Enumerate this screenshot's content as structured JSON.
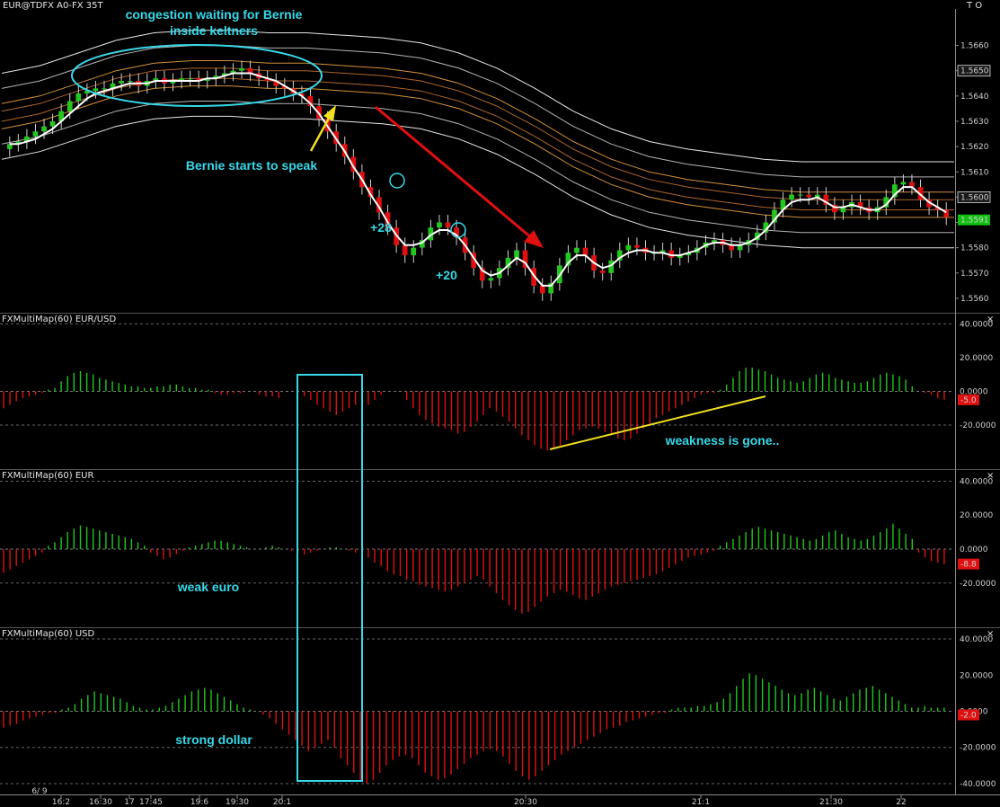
{
  "header": {
    "title": "EUR@TDFX A0-FX 35T",
    "right_label": "T O",
    "close_glyph": "×"
  },
  "colors": {
    "bg": "#000000",
    "up": "#22c81e",
    "down": "#e01010",
    "cyan": "#38d8e8",
    "yellow": "#f0e020",
    "red_arrow": "#e01010",
    "ma": "#ffffff",
    "price_tag_green": "#10c010"
  },
  "chart_data": [
    {
      "type": "candlestick",
      "title": "EUR@TDFX A0-FX 35T",
      "ylim": [
        1.5555,
        1.5673
      ],
      "y_ticks": [
        "1.5660",
        "1.5650",
        "1.5640",
        "1.5630",
        "1.5620",
        "1.5610",
        "1.5600",
        "1.5590",
        "1.5580",
        "1.5570",
        "1.5560"
      ],
      "price_tags": [
        {
          "value": "1.5650",
          "style": "box"
        },
        {
          "value": "1.5600",
          "style": "box"
        },
        {
          "value": "1.5591",
          "style": "green"
        }
      ],
      "x_labels": [
        "6/ 9",
        "16:2",
        "16:30",
        "17",
        "17:45",
        "19:6",
        "19:30",
        "20:1",
        "20:30",
        "21:1",
        "21:30",
        "22"
      ],
      "close": [
        1.5621,
        1.5622,
        1.5624,
        1.5626,
        1.5628,
        1.563,
        1.5634,
        1.5638,
        1.5641,
        1.5642,
        1.5643,
        1.5643,
        1.5645,
        1.5646,
        1.5646,
        1.5644,
        1.5646,
        1.5647,
        1.5645,
        1.5646,
        1.5647,
        1.5647,
        1.5646,
        1.5647,
        1.5648,
        1.5649,
        1.565,
        1.5651,
        1.5649,
        1.5647,
        1.5646,
        1.5644,
        1.5643,
        1.5641,
        1.564,
        1.5636,
        1.5631,
        1.5626,
        1.5621,
        1.5616,
        1.561,
        1.5604,
        1.56,
        1.5594,
        1.5588,
        1.5581,
        1.5577,
        1.558,
        1.5583,
        1.5588,
        1.559,
        1.5588,
        1.5584,
        1.5578,
        1.5572,
        1.5567,
        1.5568,
        1.5572,
        1.5576,
        1.5579,
        1.5572,
        1.5565,
        1.5562,
        1.5566,
        1.5573,
        1.5578,
        1.558,
        1.5577,
        1.5571,
        1.557,
        1.5575,
        1.5579,
        1.5581,
        1.558,
        1.5578,
        1.5578,
        1.5579,
        1.5576,
        1.5577,
        1.5578,
        1.558,
        1.5582,
        1.5583,
        1.5581,
        1.5579,
        1.5581,
        1.5583,
        1.5586,
        1.559,
        1.5595,
        1.5599,
        1.5601,
        1.5601,
        1.56,
        1.5601,
        1.5597,
        1.5594,
        1.5596,
        1.5598,
        1.5596,
        1.5594,
        1.5596,
        1.56,
        1.5605,
        1.5606,
        1.5604,
        1.5599,
        1.5596,
        1.5595,
        1.5592
      ],
      "ma": [
        1.5621,
        1.5621,
        1.5622,
        1.5623,
        1.5625,
        1.5627,
        1.563,
        1.5633,
        1.5636,
        1.5639,
        1.5641,
        1.5642,
        1.5643,
        1.5644,
        1.5645,
        1.5645,
        1.5645,
        1.5646,
        1.5646,
        1.5646,
        1.5646,
        1.5646,
        1.5646,
        1.5647,
        1.5647,
        1.5648,
        1.5649,
        1.5649,
        1.5649,
        1.5648,
        1.5647,
        1.5646,
        1.5644,
        1.5642,
        1.564,
        1.5637,
        1.5633,
        1.5628,
        1.5623,
        1.5618,
        1.5612,
        1.5607,
        1.5601,
        1.5596,
        1.559,
        1.5585,
        1.5581,
        1.5581,
        1.5582,
        1.5585,
        1.5587,
        1.5587,
        1.5585,
        1.5581,
        1.5576,
        1.5571,
        1.5569,
        1.557,
        1.5573,
        1.5576,
        1.5574,
        1.5569,
        1.5565,
        1.5565,
        1.5569,
        1.5574,
        1.5577,
        1.5577,
        1.5574,
        1.5572,
        1.5573,
        1.5576,
        1.5578,
        1.5579,
        1.5579,
        1.5578,
        1.5578,
        1.5577,
        1.5577,
        1.5578,
        1.5579,
        1.5581,
        1.5582,
        1.5582,
        1.5581,
        1.5581,
        1.5582,
        1.5584,
        1.5587,
        1.5591,
        1.5595,
        1.5598,
        1.5599,
        1.5599,
        1.56,
        1.5598,
        1.5596,
        1.5596,
        1.5597,
        1.5596,
        1.5595,
        1.5595,
        1.5597,
        1.5601,
        1.5604,
        1.5604,
        1.5601,
        1.5598,
        1.5596,
        1.5594
      ],
      "bands_mid": [
        1.5632,
        1.5635,
        1.564,
        1.5645,
        1.5648,
        1.5649,
        1.5649,
        1.5648,
        1.5648,
        1.5647,
        1.5646,
        1.5644,
        1.564,
        1.5634,
        1.5626,
        1.5617,
        1.561,
        1.5605,
        1.5602,
        1.56,
        1.5598,
        1.5597,
        1.5597,
        1.5597,
        1.5597,
        1.5597
      ],
      "band_offsets": [
        -0.0017,
        -0.0011,
        -0.0005,
        -0.0002,
        0.0002,
        0.0005,
        0.0011,
        0.0017
      ]
    },
    {
      "type": "histogram",
      "title": "FXMultiMap(60) EUR/USD",
      "ylim": [
        -45,
        45
      ],
      "y_ticks": [
        "40.0000",
        "20.0000",
        "0.0000",
        "-20.0000"
      ],
      "current": "-5.0",
      "values": [
        -10,
        -8,
        -6,
        -4,
        -3,
        -2,
        -1,
        1,
        2,
        6,
        9,
        11,
        12,
        11,
        10,
        8,
        7,
        6,
        5,
        4,
        3,
        3,
        2,
        2,
        3,
        3,
        4,
        4,
        3,
        2,
        2,
        1,
        1,
        -1,
        -2,
        -2,
        -1,
        -1,
        0,
        0,
        -2,
        -3,
        -3,
        -4,
        0,
        0,
        -1,
        -3,
        -5,
        -8,
        -10,
        -12,
        -14,
        -12,
        -10,
        -8,
        -8,
        -8,
        -5,
        -2,
        0,
        0,
        0,
        -5,
        -10,
        -14,
        -17,
        -19,
        -21,
        -22,
        -23,
        -25,
        -24,
        -21,
        -18,
        -14,
        -10,
        -12,
        -15,
        -18,
        -22,
        -26,
        -29,
        -32,
        -34,
        -35,
        -34,
        -32,
        -29,
        -26,
        -23,
        -22,
        -21,
        -22,
        -24,
        -26,
        -28,
        -29,
        -28,
        -25,
        -22,
        -19,
        -16,
        -14,
        -12,
        -10,
        -8,
        -6,
        -4,
        -2,
        -1,
        -1,
        1,
        4,
        8,
        12,
        14,
        14,
        13,
        12,
        10,
        8,
        7,
        6,
        5,
        6,
        8,
        10,
        11,
        10,
        8,
        7,
        6,
        5,
        5,
        6,
        8,
        10,
        11,
        10,
        9,
        7,
        3,
        0,
        -1,
        -2,
        -4,
        -5
      ]
    },
    {
      "type": "histogram",
      "title": "FXMultiMap(60) EUR",
      "ylim": [
        -45,
        45
      ],
      "y_ticks": [
        "40.0000",
        "20.0000",
        "0.0000",
        "-20.0000"
      ],
      "current": "-8.8",
      "values": [
        -14,
        -12,
        -10,
        -8,
        -6,
        -4,
        -2,
        2,
        4,
        7,
        10,
        12,
        14,
        13,
        12,
        11,
        10,
        9,
        8,
        7,
        6,
        4,
        2,
        -2,
        -4,
        -6,
        -5,
        -3,
        -1,
        1,
        2,
        3,
        4,
        5,
        5,
        4,
        3,
        2,
        1,
        0,
        0,
        1,
        2,
        1,
        0,
        -1,
        -2,
        -3,
        -2,
        -1,
        0,
        1,
        1,
        0,
        -1,
        -2,
        -3,
        -5,
        -8,
        -10,
        -13,
        -15,
        -16,
        -18,
        -19,
        -21,
        -22,
        -23,
        -24,
        -25,
        -24,
        -22,
        -20,
        -18,
        -16,
        -18,
        -22,
        -26,
        -30,
        -33,
        -36,
        -38,
        -37,
        -34,
        -31,
        -28,
        -26,
        -24,
        -25,
        -27,
        -29,
        -30,
        -28,
        -26,
        -24,
        -22,
        -21,
        -20,
        -19,
        -18,
        -17,
        -16,
        -15,
        -13,
        -11,
        -9,
        -7,
        -5,
        -4,
        -3,
        -2,
        -1,
        2,
        4,
        6,
        8,
        10,
        12,
        13,
        12,
        11,
        10,
        9,
        8,
        7,
        6,
        5,
        6,
        8,
        10,
        11,
        9,
        7,
        6,
        5,
        6,
        8,
        10,
        12,
        15,
        12,
        9,
        6,
        -2,
        -5,
        -7,
        -8,
        -9
      ]
    },
    {
      "type": "histogram",
      "title": "FXMultiMap(60) USD",
      "ylim": [
        -45,
        45
      ],
      "y_ticks": [
        "40.0000",
        "20.0000",
        "0.0000",
        "-20.0000",
        "-40.0000"
      ],
      "current": "-2.0",
      "values": [
        -9,
        -8,
        -7,
        -5,
        -4,
        -3,
        -2,
        -1,
        -1,
        1,
        2,
        4,
        7,
        9,
        11,
        10,
        9,
        8,
        7,
        5,
        3,
        2,
        1,
        1,
        2,
        3,
        5,
        7,
        9,
        11,
        12,
        13,
        12,
        10,
        8,
        6,
        4,
        2,
        1,
        0,
        -2,
        -4,
        -7,
        -10,
        -13,
        -16,
        -19,
        -22,
        -20,
        -18,
        -16,
        -20,
        -26,
        -30,
        -34,
        -38,
        -40,
        -38,
        -34,
        -30,
        -27,
        -25,
        -24,
        -26,
        -30,
        -34,
        -36,
        -38,
        -37,
        -35,
        -32,
        -29,
        -26,
        -24,
        -22,
        -21,
        -22,
        -25,
        -29,
        -33,
        -36,
        -38,
        -36,
        -33,
        -30,
        -27,
        -24,
        -22,
        -20,
        -18,
        -16,
        -14,
        -12,
        -10,
        -9,
        -8,
        -6,
        -5,
        -4,
        -3,
        -2,
        -1,
        -1,
        1,
        2,
        2,
        2,
        3,
        3,
        4,
        5,
        7,
        10,
        14,
        18,
        21,
        20,
        18,
        16,
        14,
        12,
        10,
        9,
        10,
        12,
        13,
        11,
        9,
        7,
        6,
        8,
        10,
        12,
        13,
        14,
        12,
        10,
        8,
        6,
        4,
        2,
        2,
        3,
        2,
        2,
        2
      ]
    }
  ],
  "annotations": {
    "congestion_line1": "congestion waiting for Bernie",
    "congestion_line2": "inside keltners",
    "bernie": "Bernie starts to speak",
    "plus28": "+28",
    "plus20": "+20",
    "weakness": "weakness is gone..",
    "weak_euro": "weak euro",
    "strong_dollar": "strong dollar"
  }
}
